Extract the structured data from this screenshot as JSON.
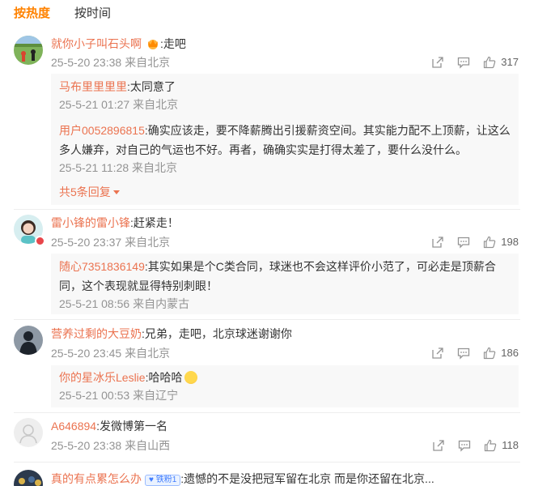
{
  "tabs": [
    {
      "label": "按热度",
      "active": true
    },
    {
      "label": "按时间",
      "active": false
    }
  ],
  "colors": {
    "accent": "#ff8200",
    "username": "#eb7350",
    "meta": "#939393"
  },
  "comments": [
    {
      "user": "就你小子叫石头啊",
      "text": ":走吧",
      "time": "25-5-20 23:38",
      "location": "来自北京",
      "likes": "317",
      "avatar_icon": "soccer-field-avatar",
      "replies": [
        {
          "user": "马布里里里里",
          "text": ":太同意了",
          "time": "25-5-21 01:27",
          "location": "来自北京"
        },
        {
          "user": "用户0052896815",
          "text": ":确实应该走，要不降薪腾出引援薪资空间。其实能力配不上顶薪，让这么多人嫌弃，对自己的气运也不好。再者，确确实实是打得太差了，要什么没什么。",
          "time": "25-5-21 11:28",
          "location": "来自北京"
        }
      ],
      "more_replies": "共5条回复"
    },
    {
      "user": "雷小锋的雷小锋",
      "text": ":赶紧走！",
      "time": "25-5-20 23:37",
      "location": "来自北京",
      "likes": "198",
      "avatar_icon": "girl-avatar",
      "replies": [
        {
          "user": "随心7351836149",
          "text": ":其实如果是个C类合同，球迷也不会这样评价小范了，可必走是顶薪合同，这个表现就显得特别刺眼！",
          "time": "25-5-21 08:56",
          "location": "来自内蒙古"
        }
      ]
    },
    {
      "user": "营养过剩的大豆奶",
      "text": ":兄弟，走吧，北京球迷谢谢你",
      "time": "25-5-20 23:45",
      "location": "来自北京",
      "likes": "186",
      "avatar_icon": "dark-figure-avatar",
      "replies": [
        {
          "user": "你的星冰乐Leslie",
          "text": ":哈哈哈",
          "time": "25-5-21 00:53",
          "location": "来自辽宁"
        }
      ]
    },
    {
      "user": "A646894",
      "text": ":发微博第一名",
      "time": "25-5-20 23:38",
      "location": "来自山西",
      "likes": "118",
      "avatar_icon": "default-user-avatar",
      "replies": []
    },
    {
      "user": "真的有点累怎么办",
      "badge": "铁粉1",
      "text": ":遗憾的不是没把冠军留在北京 而是你还留在北京...",
      "avatar_icon": "crowd-avatar"
    }
  ]
}
